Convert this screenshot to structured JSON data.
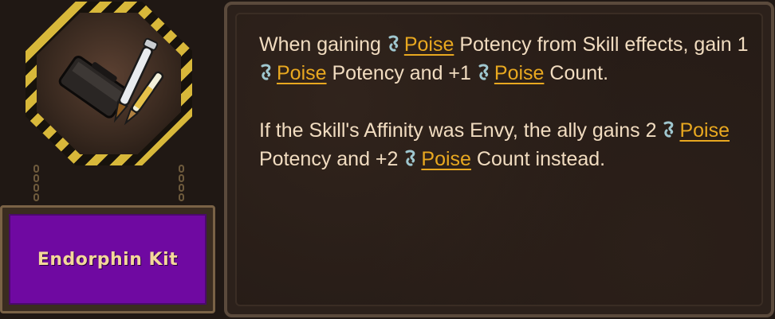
{
  "item": {
    "name": "Endorphin Kit",
    "icon": "endorphin-kit-icon"
  },
  "description": {
    "p1": {
      "t1": "When gaining ",
      "k1": "Poise",
      "t2": " Potency from Skill effects, gain 1 ",
      "k2": "Poise",
      "t3": " Potency and +1 ",
      "k3": "Poise",
      "t4": " Count."
    },
    "p2": {
      "t1": "If the Skill's Affinity was Envy, the ally gains 2 ",
      "k1": "Poise",
      "t2": " Potency and +2 ",
      "k2": "Poise",
      "t3": " Count instead."
    }
  },
  "colors": {
    "keyword": "#e8a820",
    "text": "#f1dcc0",
    "name_plate": "#6f09a1",
    "hazard_stripe": "#d8b83a"
  }
}
